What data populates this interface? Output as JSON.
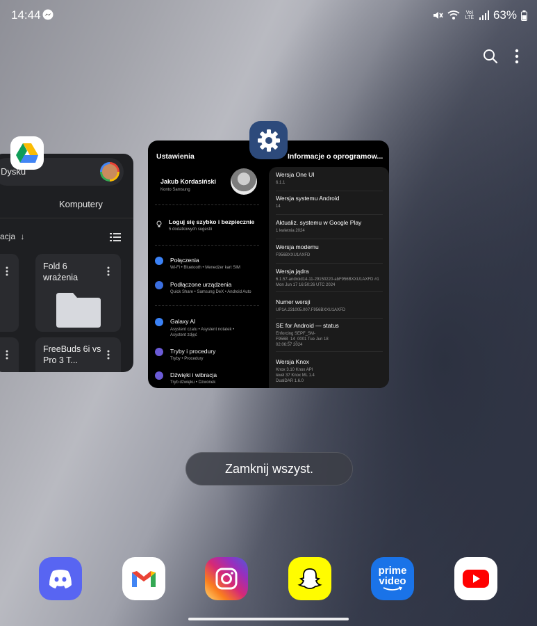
{
  "status": {
    "time": "14:44",
    "battery": "63%",
    "volte": "Vo) LTE"
  },
  "drive_card": {
    "search_text": "Dysku",
    "tab_label": "Komputery",
    "sort_label": "acja",
    "folders": [
      {
        "name": "Fold 6 wrażenia"
      },
      {
        "name": "FreeBuds 6i vs Pro 3 T..."
      }
    ]
  },
  "settings_card": {
    "title": "Ustawienia",
    "profile": {
      "name": "Jakub Kordasiński",
      "sub": "Konto Samsung"
    },
    "suggestion": {
      "title": "Loguj się szybko i bezpiecznie",
      "sub": "5 dodatkowych sugestii"
    },
    "items": [
      {
        "title": "Połączenia",
        "sub": "Wi-Fi • Bluetooth • Menedżer kart SIM",
        "color": "#3b82f6"
      },
      {
        "title": "Podłączone urządzenia",
        "sub": "Quick Share • Samsung DeX • Android Auto",
        "color": "#3b6fe0"
      },
      {
        "title": "Galaxy AI",
        "sub": "Asystent czatu • Asystent notatek • Asystent zdjęć",
        "color": "#3b82f6"
      },
      {
        "title": "Tryby i procedury",
        "sub": "Tryby • Procedury",
        "color": "#6b5bd6"
      },
      {
        "title": "Dźwięki i wibracja",
        "sub": "Tryb dźwięku • Dzwonek",
        "color": "#6b5bd6"
      }
    ],
    "info_title": "Informacje o oprogramow...",
    "info": [
      {
        "title": "Wersja One UI",
        "sub": "6.1.1"
      },
      {
        "title": "Wersja systemu Android",
        "sub": "14"
      },
      {
        "title": "Aktualiz. systemu w Google Play",
        "sub": "1 kwietnia 2024"
      },
      {
        "title": "Wersja modemu",
        "sub": "F956BXXU1AXFD"
      },
      {
        "title": "Wersja jądra",
        "sub": "6.1.57-android14-11-29150220-abF956BXXU1AXFD #1 Mon Jun 17 16:50:26 UTC 2024"
      },
      {
        "title": "Numer wersji",
        "sub": "UP1A.231005.007.F956BXXU1AXFD"
      },
      {
        "title": "SE for Android — status",
        "sub": "Enforcing SEPF_SM-F956B_14_0001 Tue Jun 18 02:06:57 2024"
      },
      {
        "title": "Wersja Knox",
        "sub": "Knox 3.10 Knox API level 37 Knox ML 1.4 DualDAR 1.6.0"
      }
    ]
  },
  "close_all_label": "Zamknij wszyst.",
  "dock": {
    "apps": [
      {
        "name": "Discord",
        "color": "#5865F2"
      },
      {
        "name": "Gmail",
        "color": "#ffffff"
      },
      {
        "name": "Instagram",
        "color": "#d6249f"
      },
      {
        "name": "Snapchat",
        "color": "#FFFC00"
      },
      {
        "name": "Prime Video",
        "color": "#1a73e8",
        "label_line1": "prime",
        "label_line2": "video"
      },
      {
        "name": "YouTube",
        "color": "#ffffff"
      }
    ]
  }
}
